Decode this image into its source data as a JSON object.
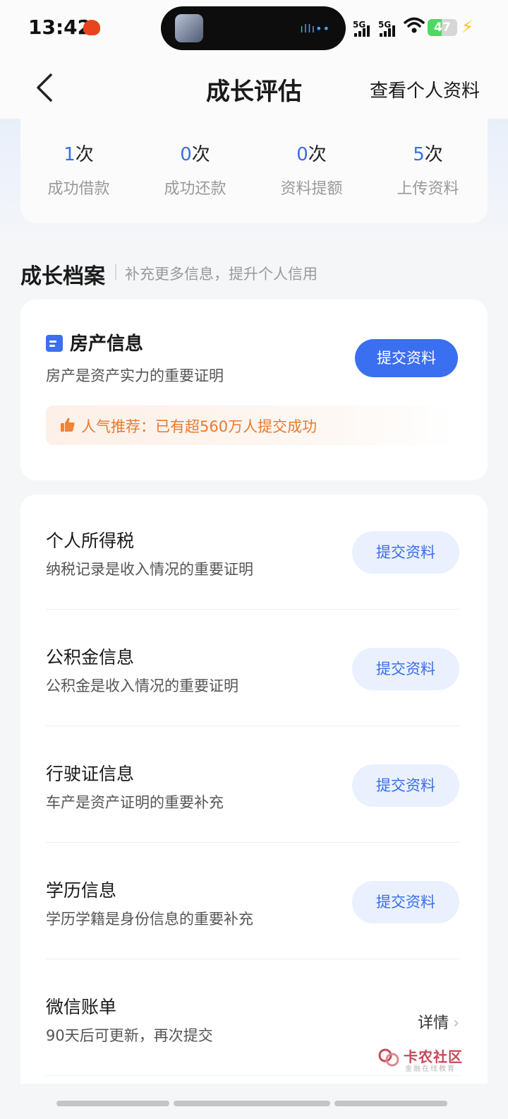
{
  "status_bar": {
    "time": "13:42",
    "signal_1": "5G",
    "signal_2": "5G",
    "battery_level": 47,
    "battery_text": "47",
    "island_wave": "ıllı••"
  },
  "navbar": {
    "title": "成长评估",
    "right_link": "查看个人资料"
  },
  "stats": [
    {
      "count": "1",
      "unit": "次",
      "label": "成功借款"
    },
    {
      "count": "0",
      "unit": "次",
      "label": "成功还款"
    },
    {
      "count": "0",
      "unit": "次",
      "label": "资料提额"
    },
    {
      "count": "5",
      "unit": "次",
      "label": "上传资料"
    }
  ],
  "section": {
    "title": "成长档案",
    "subtitle": "补充更多信息，提升个人信用"
  },
  "property": {
    "title": "房产信息",
    "desc": "房产是资产实力的重要证明",
    "button": "提交资料",
    "promo": "人气推荐：已有超560万人提交成功"
  },
  "items": [
    {
      "title": "个人所得税",
      "desc": "纳税记录是收入情况的重要证明",
      "button": "提交资料"
    },
    {
      "title": "公积金信息",
      "desc": "公积金是收入情况的重要证明",
      "button": "提交资料"
    },
    {
      "title": "行驶证信息",
      "desc": "车产是资产证明的重要补充",
      "button": "提交资料"
    },
    {
      "title": "学历信息",
      "desc": "学历学籍是身份信息的重要补充",
      "button": "提交资料"
    }
  ],
  "wechat": {
    "title": "微信账单",
    "desc": "90天后可更新，再次提交",
    "link": "详情",
    "chevron": "›"
  },
  "watermark": {
    "title": "卡农社区",
    "subtitle": "金融在线教育"
  },
  "colors": {
    "accent": "#3a6ff0",
    "promo_text": "#e87a2e",
    "soft_button_bg": "#eaf0fd"
  }
}
